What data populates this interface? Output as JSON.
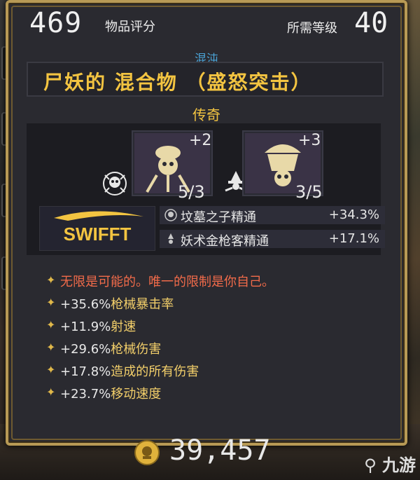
{
  "item": {
    "score_value": "469",
    "score_label": "物品评分",
    "req_label": "所需等级",
    "req_value": "40",
    "manufacturer": "混沌",
    "name": "尸妖的 混合物 （盛怒突击）",
    "rarity": "传奇"
  },
  "skills": [
    {
      "plus": "+2",
      "fraction": "5/3"
    },
    {
      "plus": "+3",
      "fraction": "3/5"
    }
  ],
  "brand_logo": "SWIFFT",
  "masteries": [
    {
      "name": "坟墓之子精通",
      "value": "+34.3%"
    },
    {
      "name": "妖术金枪客精通",
      "value": "+17.1%"
    }
  ],
  "flavor": "无限是可能的。唯一的限制是你自己。",
  "stats": [
    {
      "value": "+35.6%",
      "label": "枪械暴击率"
    },
    {
      "value": "+11.9%",
      "label": "射速"
    },
    {
      "value": "+29.6%",
      "label": "枪械伤害"
    },
    {
      "value": "+17.8%",
      "label": "造成的所有伤害"
    },
    {
      "value": "+23.7%",
      "label": "移动速度"
    }
  ],
  "price": "39,457",
  "watermark": "九游",
  "colors": {
    "gold": "#f3c441",
    "chaos_blue": "#4aa3d6",
    "flavor_red": "#f26b4a",
    "border_gold": "#b89a55"
  },
  "icons": [
    "skull-skill-icon",
    "cauldron-skill-icon",
    "class-skull-icon",
    "class-gunslinger-icon",
    "currency-coin-icon"
  ]
}
